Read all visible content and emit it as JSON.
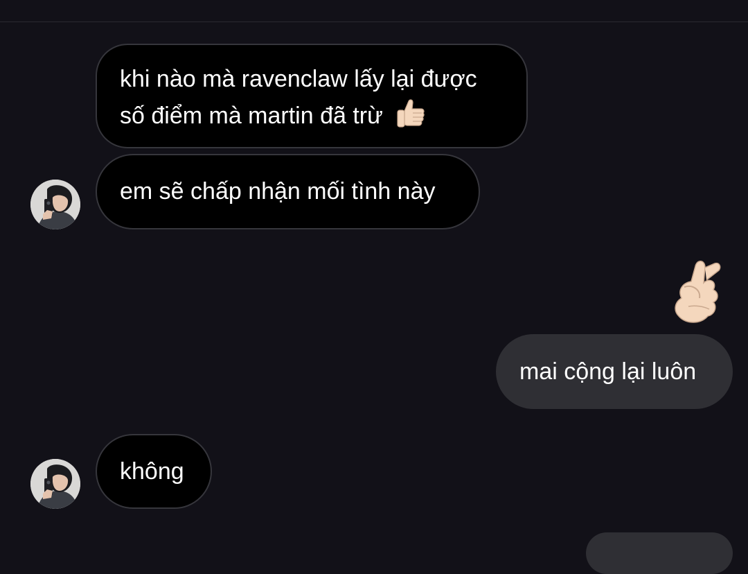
{
  "messages": [
    {
      "direction": "received",
      "line1": "khi nào mà ravenclaw lấy lại được",
      "line2": "số điểm mà martin đã trừ",
      "emoji": "thumbs-up-icon"
    },
    {
      "direction": "received",
      "text": "em sẽ chấp nhận mối tình này"
    },
    {
      "direction": "sent",
      "reaction": "hand-with-index-finger-and-thumb-crossed-icon"
    },
    {
      "direction": "sent",
      "text": "mai cộng lại luôn"
    },
    {
      "direction": "received",
      "text": "không"
    }
  ],
  "colors": {
    "background": "#121118",
    "received_bubble": "#000000",
    "received_border": "#36363c",
    "sent_bubble": "#2f2f34",
    "text": "#ffffff",
    "skin_tone": "#f4d7bd"
  }
}
